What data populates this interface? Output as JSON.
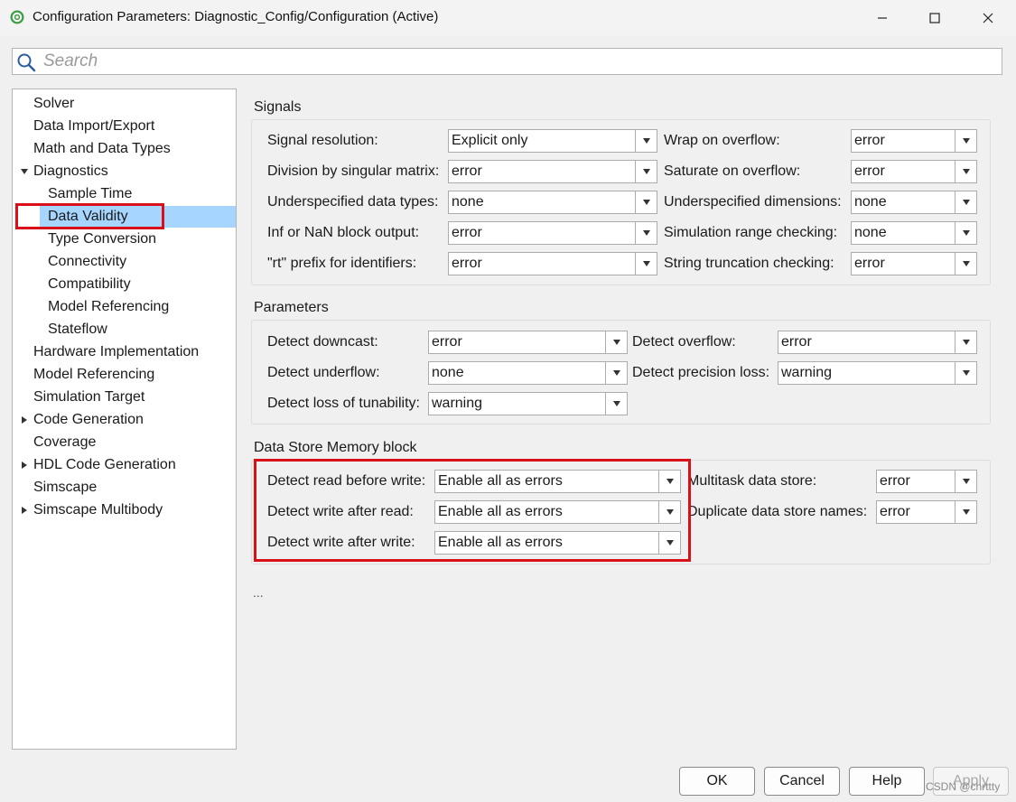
{
  "window": {
    "title": "Configuration Parameters: Diagnostic_Config/Configuration (Active)",
    "buttons": [
      "minimize",
      "maximize",
      "close"
    ]
  },
  "search": {
    "placeholder": "Search"
  },
  "tree": {
    "items": [
      {
        "label": "Solver",
        "level": 0,
        "expander": "none"
      },
      {
        "label": "Data Import/Export",
        "level": 0,
        "expander": "none"
      },
      {
        "label": "Math and Data Types",
        "level": 0,
        "expander": "none"
      },
      {
        "label": "Diagnostics",
        "level": 0,
        "expander": "expanded"
      },
      {
        "label": "Sample Time",
        "level": 1,
        "expander": "none"
      },
      {
        "label": "Data Validity",
        "level": 1,
        "expander": "none",
        "selected": true
      },
      {
        "label": "Type Conversion",
        "level": 1,
        "expander": "none"
      },
      {
        "label": "Connectivity",
        "level": 1,
        "expander": "none"
      },
      {
        "label": "Compatibility",
        "level": 1,
        "expander": "none"
      },
      {
        "label": "Model Referencing",
        "level": 1,
        "expander": "none"
      },
      {
        "label": "Stateflow",
        "level": 1,
        "expander": "none"
      },
      {
        "label": "Hardware Implementation",
        "level": 0,
        "expander": "none"
      },
      {
        "label": "Model Referencing",
        "level": 0,
        "expander": "none"
      },
      {
        "label": "Simulation Target",
        "level": 0,
        "expander": "none"
      },
      {
        "label": "Code Generation",
        "level": 0,
        "expander": "collapsed"
      },
      {
        "label": "Coverage",
        "level": 0,
        "expander": "none"
      },
      {
        "label": "HDL Code Generation",
        "level": 0,
        "expander": "collapsed"
      },
      {
        "label": "Simscape",
        "level": 0,
        "expander": "none"
      },
      {
        "label": "Simscape Multibody",
        "level": 0,
        "expander": "collapsed"
      }
    ]
  },
  "signals": {
    "title": "Signals",
    "left": [
      {
        "label": "Signal resolution:",
        "value": "Explicit only"
      },
      {
        "label": "Division by singular matrix:",
        "value": "error"
      },
      {
        "label": "Underspecified data types:",
        "value": "none"
      },
      {
        "label": "Inf or NaN block output:",
        "value": "error"
      },
      {
        "label": "\"rt\" prefix for identifiers:",
        "value": "error"
      }
    ],
    "right": [
      {
        "label": "Wrap on overflow:",
        "value": "error"
      },
      {
        "label": "Saturate on overflow:",
        "value": "error"
      },
      {
        "label": "Underspecified dimensions:",
        "value": "none"
      },
      {
        "label": "Simulation range checking:",
        "value": "none"
      },
      {
        "label": "String truncation checking:",
        "value": "error"
      }
    ]
  },
  "parameters": {
    "title": "Parameters",
    "left": [
      {
        "label": "Detect downcast:",
        "value": "error"
      },
      {
        "label": "Detect underflow:",
        "value": "none"
      },
      {
        "label": "Detect loss of tunability:",
        "value": "warning"
      }
    ],
    "right": [
      {
        "label": "Detect overflow:",
        "value": "error"
      },
      {
        "label": "Detect precision loss:",
        "value": "warning"
      }
    ]
  },
  "dsm": {
    "title": "Data Store Memory block",
    "left": [
      {
        "label": "Detect read before write:",
        "value": "Enable all as errors"
      },
      {
        "label": "Detect write after read:",
        "value": "Enable all as errors"
      },
      {
        "label": "Detect write after write:",
        "value": "Enable all as errors"
      }
    ],
    "right": [
      {
        "label": "Multitask data store:",
        "value": "error"
      },
      {
        "label": "Duplicate data store names:",
        "value": "error"
      }
    ]
  },
  "more": "...",
  "footer": {
    "ok": "OK",
    "cancel": "Cancel",
    "help": "Help",
    "apply": "Apply",
    "apply_enabled": false
  },
  "watermark": "CSDN @chrttty",
  "colors": {
    "selection": "#a6d6ff",
    "highlight_border": "#d9101a"
  }
}
